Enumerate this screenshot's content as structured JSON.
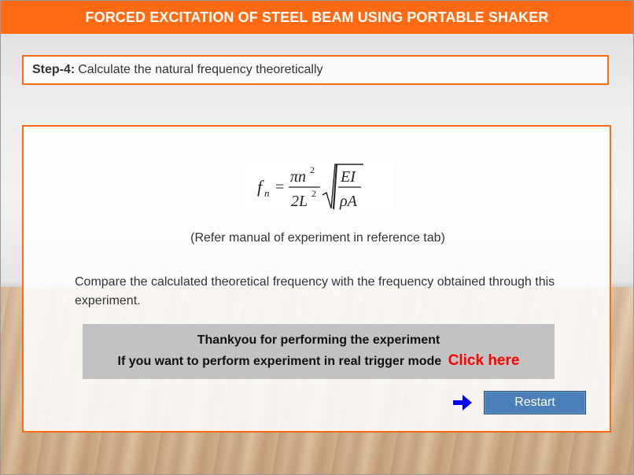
{
  "header": {
    "title": "FORCED EXCITATION OF STEEL BEAM USING PORTABLE SHAKER"
  },
  "step": {
    "label": "Step-4:",
    "text": "Calculate the natural frequency theoretically"
  },
  "formula": {
    "lhs": "f",
    "lhs_sub": "n",
    "equals": "=",
    "numerator": "πn",
    "numerator_exp": "2",
    "denominator": "2L",
    "denominator_exp": "2",
    "root_numerator": "EI",
    "root_denominator": "ρA"
  },
  "main": {
    "reference_note": "(Refer manual of experiment in reference tab)",
    "compare_text": "Compare the calculated theoretical frequency with the frequency obtained through this experiment."
  },
  "thanks": {
    "line1": "Thankyou for performing the experiment",
    "line2": "If you want to perform experiment in real trigger mode",
    "link": "Click here"
  },
  "actions": {
    "restart_label": "Restart",
    "arrow_icon": "arrow-right-icon",
    "arrow_color": "#0000ff"
  },
  "colors": {
    "accent": "#ff6a13",
    "button": "#4a7fb8",
    "link": "#ff0000"
  }
}
